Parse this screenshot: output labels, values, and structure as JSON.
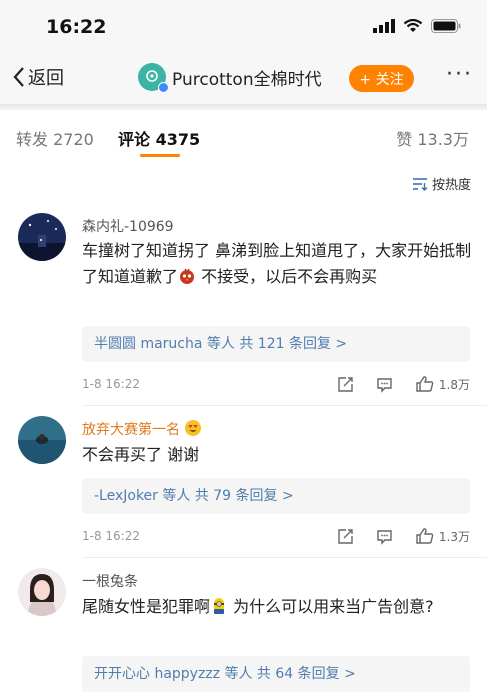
{
  "status_bar": {
    "time": "16:22"
  },
  "nav": {
    "back_label": "返回",
    "account_name": "Purcotton全棉时代",
    "logo_text": "Purcotton",
    "follow_label": "+ 关注",
    "more_label": "···"
  },
  "tabs": {
    "repost_label": "转发",
    "repost_count": "2720",
    "comment_label": "评论",
    "comment_count": "4375",
    "like_label": "赞",
    "like_count": "13.3万"
  },
  "sort": {
    "label": "按热度"
  },
  "comments": [
    {
      "user": "森内礼-10969",
      "text_before": "车撞树了知道拐了 鼻涕到脸上知道甩了，大家开始抵制了知道道歉了",
      "text_after": " 不接受，以后不会再购买",
      "reply_summary": "半圆圆 marucha 等人  共 121 条回复 >",
      "date": "1-8 16:22",
      "likes": "1.8万"
    },
    {
      "user": "放弃大赛第一名",
      "text": "不会再买了 谢谢",
      "reply_summary": "-LexJoker 等人  共 79 条回复 >",
      "date": "1-8 16:22",
      "likes": "1.3万"
    },
    {
      "user": "一根兔条",
      "text_before": "尾随女性是犯罪啊",
      "text_after": " 为什么可以用来当广告创意?",
      "reply_summary": "开开心心 happyzzz 等人  共 64 条回复 >"
    }
  ],
  "colors": {
    "accent": "#ff8200",
    "link": "#507daf",
    "name_highlight": "#e07b1f",
    "brand": "#3cb3a4"
  }
}
